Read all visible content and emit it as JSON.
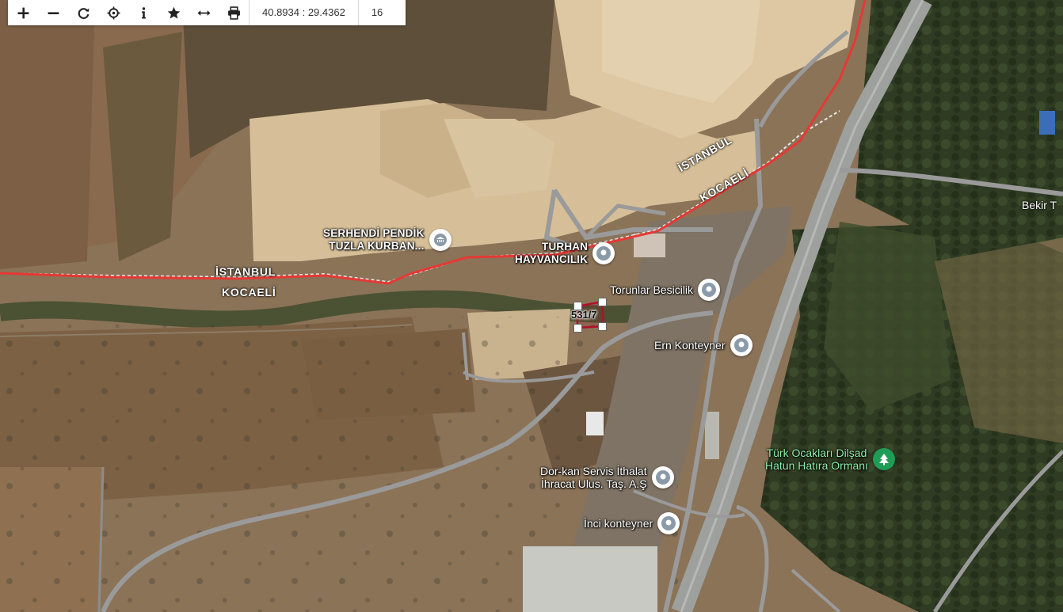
{
  "toolbar": {
    "buttons": [
      {
        "icon": "zoom-in-icon"
      },
      {
        "icon": "zoom-out-icon"
      },
      {
        "icon": "refresh-icon"
      },
      {
        "icon": "locate-icon"
      },
      {
        "icon": "info-icon"
      },
      {
        "icon": "star-icon"
      },
      {
        "icon": "measure-icon"
      },
      {
        "icon": "print-icon"
      }
    ],
    "coordinates": "40.8934 : 29.4362",
    "zoom_level": "16"
  },
  "map": {
    "boundary_labels": {
      "upper_istanbul": "İSTANBUL",
      "upper_kocaeli": "KOCAELİ",
      "lower_istanbul": "İSTANBUL",
      "lower_kocaeli": "KOCAELİ"
    },
    "parcel_label": "531/7",
    "road_label": "Bekir T",
    "colors": {
      "boundary_line": "#e53935",
      "parcel_outline": "#b0102a",
      "road": "#9a9a9a",
      "poi_icon": "#8a9aa8",
      "park_icon": "#1f9d56"
    },
    "pois": [
      {
        "line1": "SERHENDİ PENDİK",
        "line2": "TUZLA KURBAN...",
        "icon": "institution-icon"
      },
      {
        "line1": "TURHAN",
        "line2": "HAYVANCILIK",
        "icon": "location-pin-icon"
      },
      {
        "line1": "Torunlar Besicilik",
        "icon": "location-pin-icon"
      },
      {
        "line1": "Ern Konteyner",
        "icon": "location-pin-icon"
      },
      {
        "line1": "Dor-kan Servis İthalat",
        "line2": "İhracat Ulus. Taş. A.Ş",
        "icon": "location-pin-icon"
      },
      {
        "line1": "İnci konteyner",
        "icon": "location-pin-icon"
      },
      {
        "line1": "Türk Ocakları Dilşad",
        "line2": "Hatun Hatıra Ormanı",
        "icon": "tree-icon"
      }
    ]
  }
}
